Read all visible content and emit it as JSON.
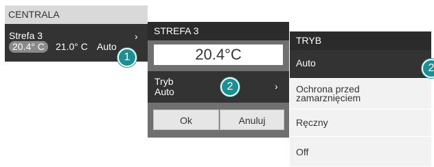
{
  "panel_central": {
    "title": "CENTRALA",
    "zone_name": "Strefa 3",
    "current_temp": "20.4° C",
    "set_temp": "21.0° C",
    "mode": "Auto",
    "chevron": "›"
  },
  "panel_zone": {
    "title": "STREFA 3",
    "temperature": "20.4°C",
    "mode_label": "Tryb",
    "mode_value": "Auto",
    "chevron": "›",
    "ok_label": "Ok",
    "cancel_label": "Anuluj"
  },
  "panel_mode": {
    "title": "TRYB",
    "options": [
      {
        "label": "Auto"
      },
      {
        "label": "Ochrona przed",
        "label2": "zamarznięciem"
      },
      {
        "label": "Ręczny"
      },
      {
        "label": "Off"
      }
    ]
  },
  "callouts": [
    "1",
    "2",
    "2"
  ],
  "colors": {
    "dark_bg": "#333333",
    "header_dark": "#2b2b2b",
    "header_light": "#d9d9d9",
    "callout": "#1f8e93"
  }
}
